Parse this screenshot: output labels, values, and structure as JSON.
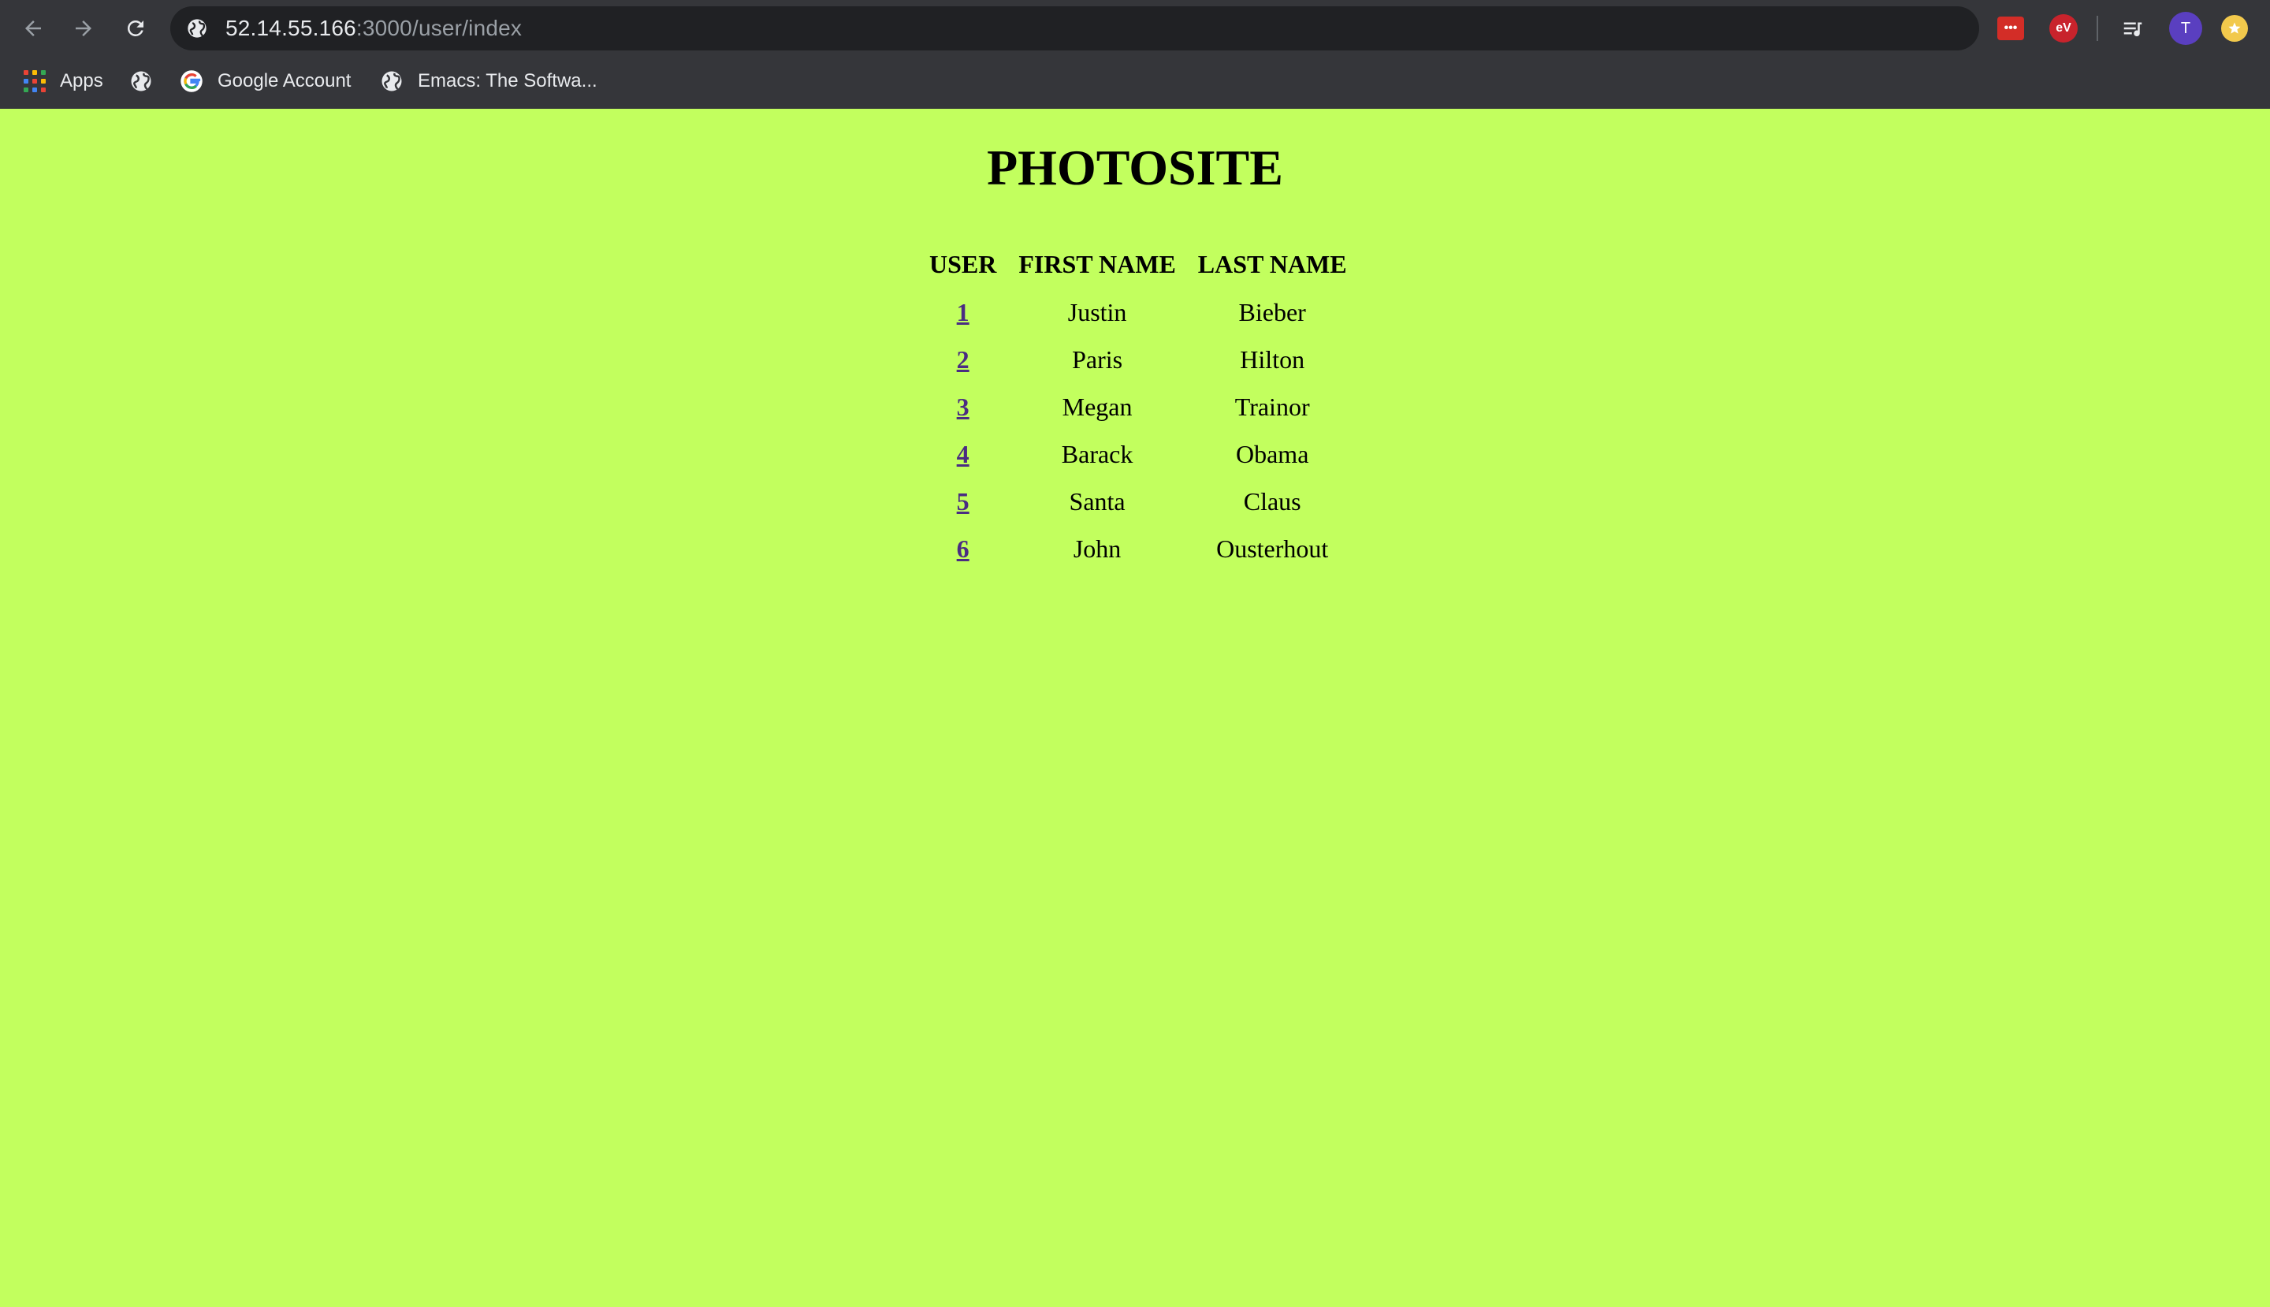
{
  "browser": {
    "url_host": "52.14.55.166",
    "url_rest": ":3000/user/index",
    "bookmarks": [
      {
        "label": "Apps",
        "icon": "apps-grid-icon"
      },
      {
        "label": "",
        "icon": "globe-icon"
      },
      {
        "label": "Google Account",
        "icon": "google-icon"
      },
      {
        "label": "Emacs: The Softwa...",
        "icon": "globe-icon"
      }
    ],
    "avatar_initial": "T",
    "vpn_badge": "eV",
    "lastpass_badge": "•••"
  },
  "page": {
    "title": "PHOTOSITE",
    "background": "#c2ff5e",
    "columns": [
      "USER",
      "FIRST NAME",
      "LAST NAME"
    ],
    "rows": [
      {
        "id": "1",
        "first": "Justin",
        "last": "Bieber"
      },
      {
        "id": "2",
        "first": "Paris",
        "last": "Hilton"
      },
      {
        "id": "3",
        "first": "Megan",
        "last": "Trainor"
      },
      {
        "id": "4",
        "first": "Barack",
        "last": "Obama"
      },
      {
        "id": "5",
        "first": "Santa",
        "last": "Claus"
      },
      {
        "id": "6",
        "first": "John",
        "last": "Ousterhout"
      }
    ]
  }
}
